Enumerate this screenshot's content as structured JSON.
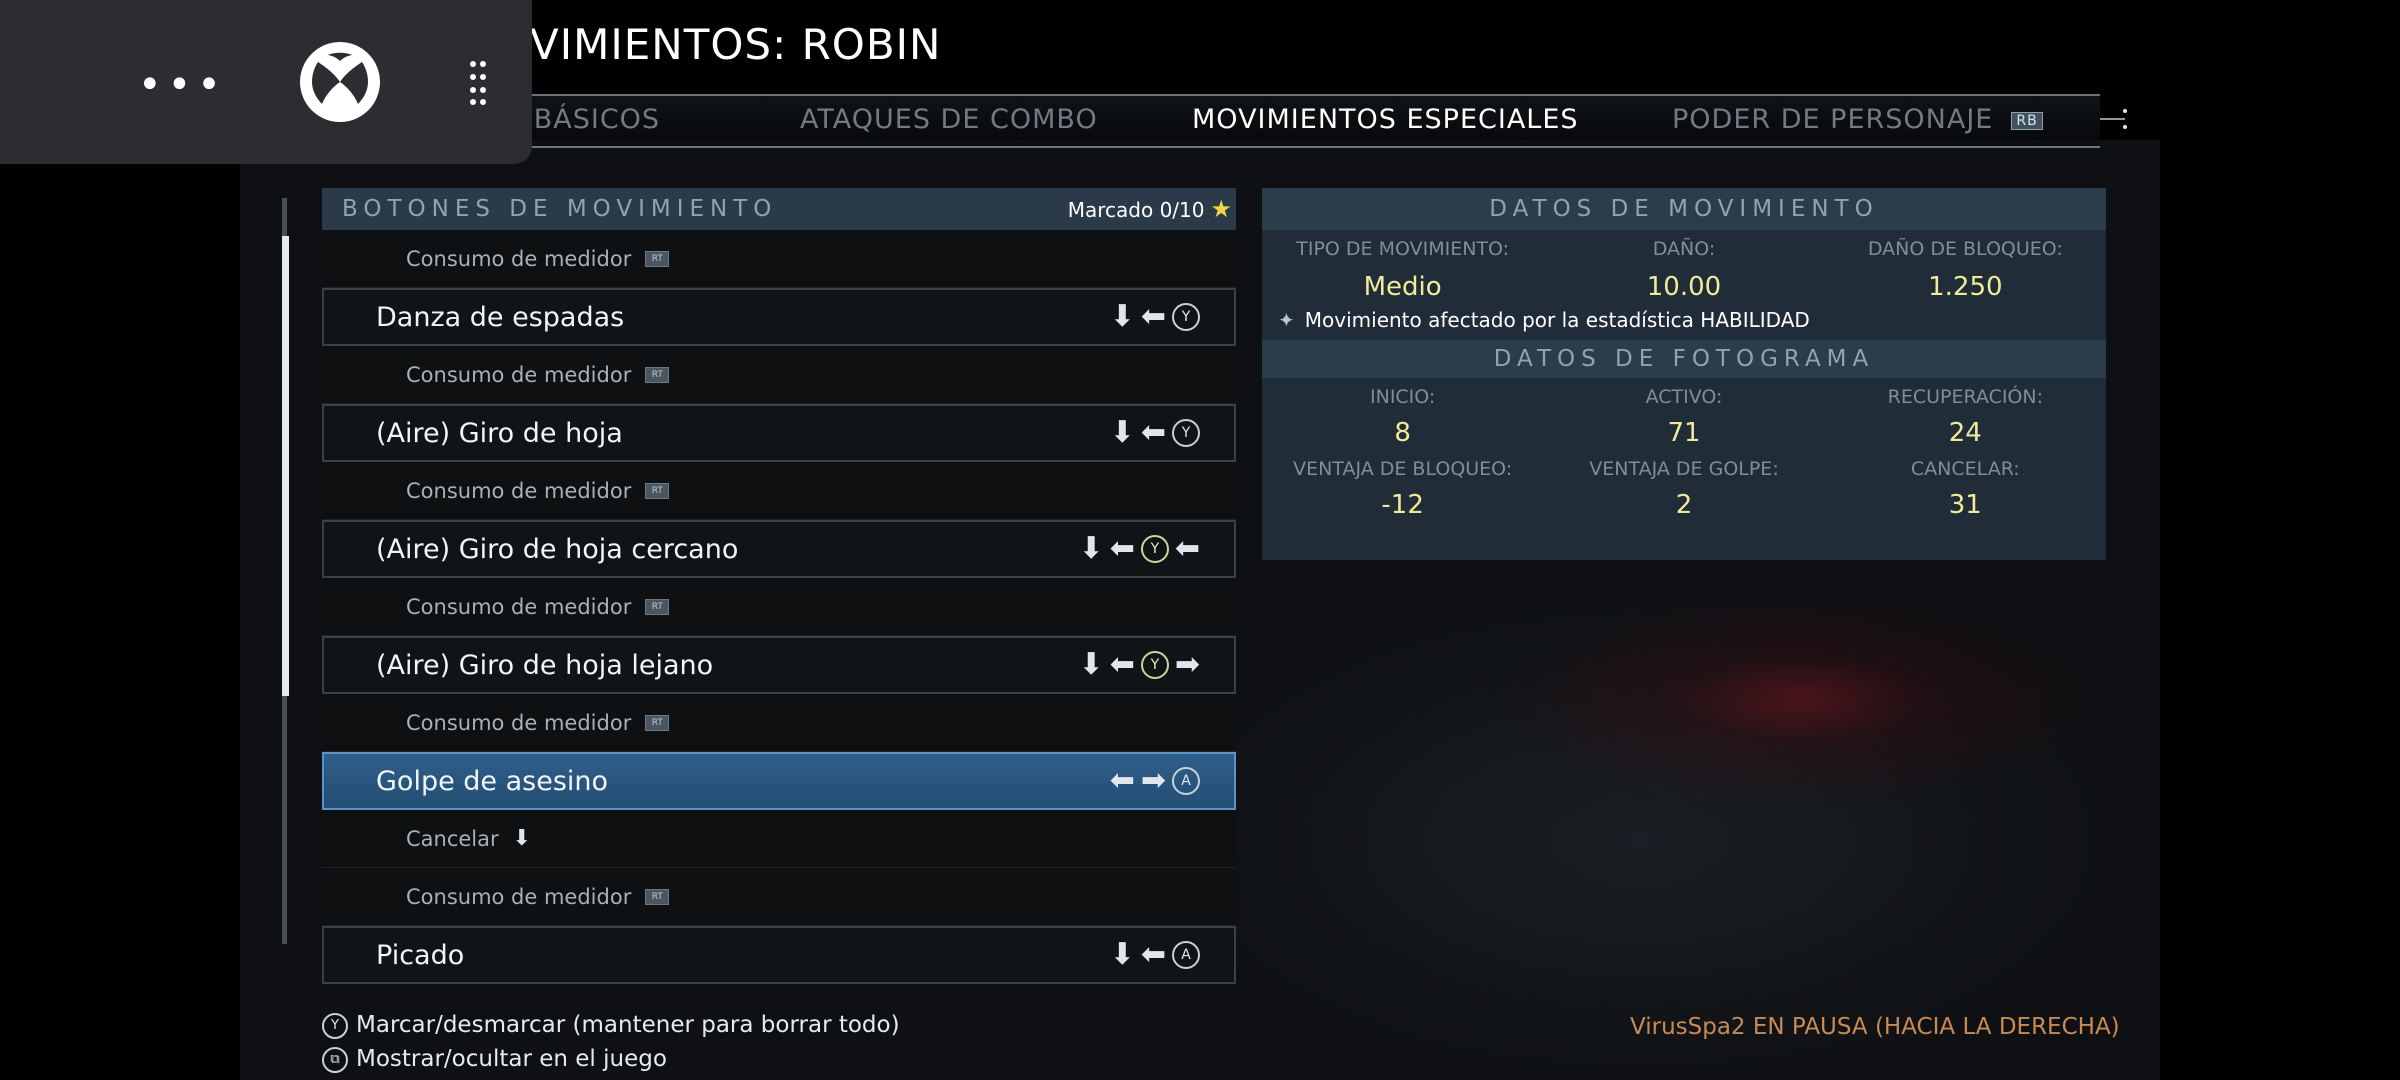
{
  "title": "VIMIENTOS: ROBIN",
  "tabs": [
    {
      "label": "S BÁSICOS",
      "active": false
    },
    {
      "label": "ATAQUES DE COMBO",
      "active": false
    },
    {
      "label": "MOVIMIENTOS ESPECIALES",
      "active": true
    },
    {
      "label": "PODER DE PERSONAJE",
      "active": false
    }
  ],
  "tab_rb": "RB",
  "list": {
    "header": "BOTONES DE MOVIMIENTO",
    "marcado": "Marcado 0/10",
    "rows": [
      {
        "type": "sub",
        "label": "Consumo de medidor",
        "icon": "RT"
      },
      {
        "type": "move",
        "label": "Danza de espadas",
        "inputs": [
          "down-arrow",
          "left-arrow",
          "Y"
        ]
      },
      {
        "type": "sub",
        "label": "Consumo de medidor",
        "icon": "RT"
      },
      {
        "type": "move",
        "label": "(Aire) Giro de hoja",
        "inputs": [
          "down-arrow",
          "left-arrow",
          "Y"
        ]
      },
      {
        "type": "sub",
        "label": "Consumo de medidor",
        "icon": "RT"
      },
      {
        "type": "move",
        "label": "(Aire) Giro de hoja cercano",
        "inputs": [
          "down-arrow",
          "left-arrow",
          "Y",
          "left-arrow"
        ]
      },
      {
        "type": "sub",
        "label": "Consumo de medidor",
        "icon": "RT"
      },
      {
        "type": "move",
        "label": "(Aire) Giro de hoja lejano",
        "inputs": [
          "down-arrow",
          "left-arrow",
          "Y",
          "right-arrow"
        ]
      },
      {
        "type": "sub",
        "label": "Consumo de medidor",
        "icon": "RT"
      },
      {
        "type": "move",
        "label": "Golpe de asesino",
        "inputs": [
          "left-arrow",
          "right-arrow",
          "A"
        ],
        "selected": true
      },
      {
        "type": "sub",
        "label": "Cancelar",
        "icon": "down-arrow"
      },
      {
        "type": "sub",
        "label": "Consumo de medidor",
        "icon": "RT"
      },
      {
        "type": "move",
        "label": "Picado",
        "inputs": [
          "down-arrow",
          "left-arrow",
          "A"
        ]
      }
    ]
  },
  "move_data": {
    "header": "DATOS DE MOVIMIENTO",
    "labels": [
      "TIPO DE MOVIMIENTO:",
      "DAÑO:",
      "DAÑO DE BLOQUEO:"
    ],
    "values": [
      "Medio",
      "10.00",
      "1.250"
    ],
    "effect": "Movimiento afectado por la estadística HABILIDAD"
  },
  "frame_data": {
    "header": "DATOS DE FOTOGRAMA",
    "labels1": [
      "INICIO:",
      "ACTIVO:",
      "RECUPERACIÓN:"
    ],
    "values1": [
      "8",
      "71",
      "24"
    ],
    "labels2": [
      "VENTAJA DE BLOQUEO:",
      "VENTAJA DE GOLPE:",
      "CANCELAR:"
    ],
    "values2": [
      "-12",
      "2",
      "31"
    ]
  },
  "footer": {
    "mark_button": "Y",
    "mark": "Marcar/desmarcar (mantener para borrar todo)",
    "toggle": "Mostrar/ocultar en el juego",
    "pause": "VirusSpa2 EN PAUSA (HACIA LA DERECHA)"
  },
  "colors": {
    "accent_selected": "#2f5f8a",
    "value_text": "#f0ea9a",
    "pause_text": "#c98a52",
    "star": "#f2d547"
  }
}
